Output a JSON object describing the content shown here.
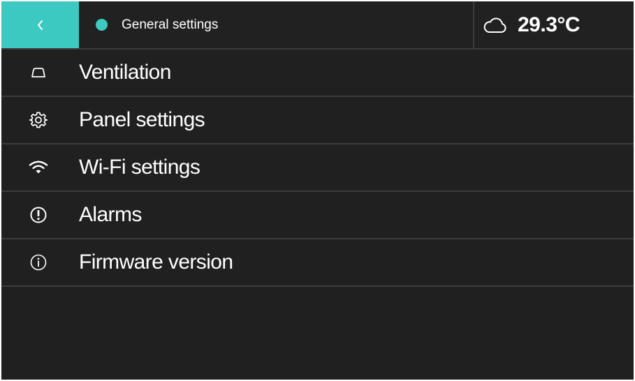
{
  "colors": {
    "accent": "#3cc9c1",
    "background": "#202020",
    "divider": "#3c3c3c",
    "text": "#ffffff"
  },
  "header": {
    "back_icon": "chevron-left-icon",
    "title": "General settings",
    "status_icon": "status-dot-icon",
    "weather_icon": "cloud-icon",
    "temperature": "29.3°C"
  },
  "menu": {
    "items": [
      {
        "label": "Ventilation",
        "icon": "ventilation-icon"
      },
      {
        "label": "Panel settings",
        "icon": "gear-icon"
      },
      {
        "label": "Wi-Fi settings",
        "icon": "wifi-icon"
      },
      {
        "label": "Alarms",
        "icon": "alarm-icon"
      },
      {
        "label": "Firmware version",
        "icon": "info-icon"
      }
    ]
  }
}
